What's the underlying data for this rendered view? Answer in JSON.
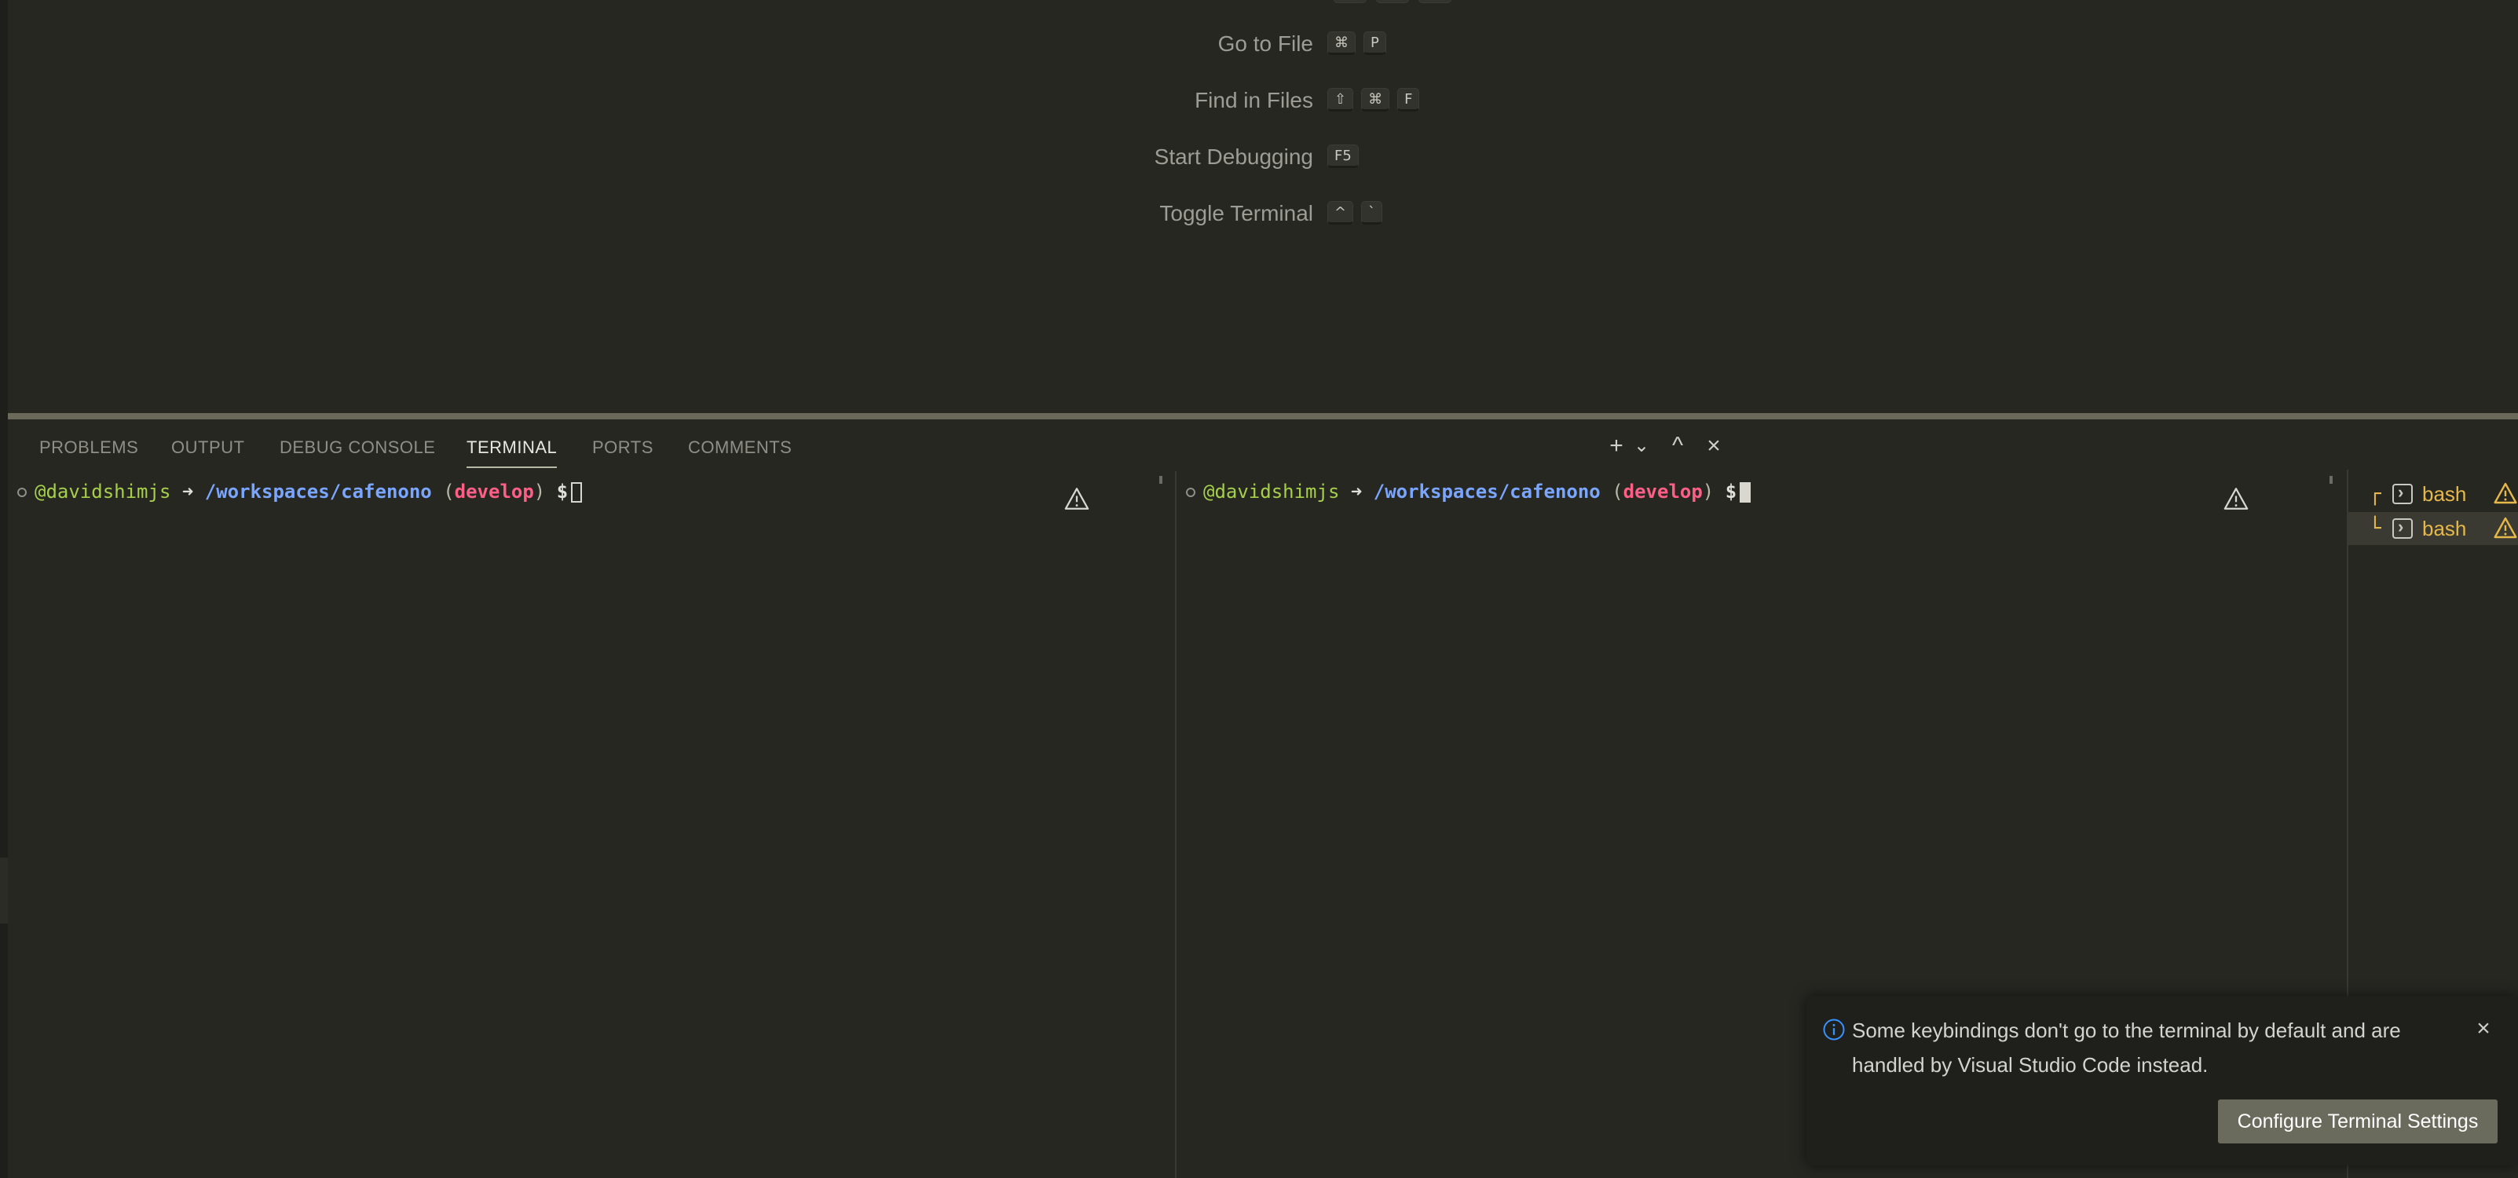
{
  "editor": {
    "shortcuts": [
      {
        "label": "Go to File",
        "keys": [
          "⌘",
          "P"
        ]
      },
      {
        "label": "Find in Files",
        "keys": [
          "⇧",
          "⌘",
          "F"
        ]
      },
      {
        "label": "Start Debugging",
        "keys": [
          "F5"
        ]
      },
      {
        "label": "Toggle Terminal",
        "keys": [
          "^",
          "`"
        ]
      }
    ]
  },
  "panel": {
    "tabs": [
      {
        "label": "PROBLEMS"
      },
      {
        "label": "OUTPUT"
      },
      {
        "label": "DEBUG CONSOLE"
      },
      {
        "label": "TERMINAL"
      },
      {
        "label": "PORTS"
      },
      {
        "label": "COMMENTS"
      }
    ],
    "active_tab": "TERMINAL",
    "actions": {
      "new": "+",
      "dropdown": "⌄",
      "maximize": "^",
      "close": "×"
    }
  },
  "terminals": {
    "prompt": {
      "user": "@davidshimjs",
      "arrow": "➜",
      "path": "/workspaces/cafenono",
      "paren_open": "(",
      "branch": "develop",
      "paren_close": ")",
      "dollar": "$"
    },
    "list": [
      {
        "tree": "┌",
        "name": "bash"
      },
      {
        "tree": "└",
        "name": "bash"
      }
    ]
  },
  "toast": {
    "message": "Some keybindings don't go to the terminal by default and are handled by Visual Studio Code instead.",
    "button_label": "Configure Terminal Settings",
    "close": "×"
  },
  "colors": {
    "background": "#272722",
    "user": "#a6cf4a",
    "path": "#7aa6ff",
    "branch": "#ff5f87",
    "warning": "#e6b84a",
    "info": "#3794ff",
    "button": "#6b6b5d"
  }
}
